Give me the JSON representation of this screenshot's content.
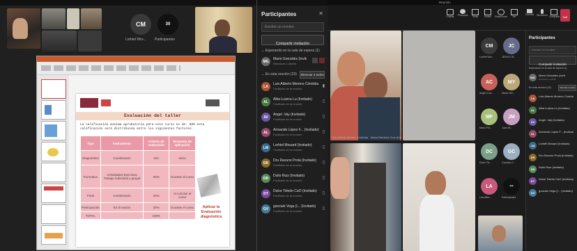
{
  "left_meeting": {
    "tiles": [
      {
        "label": "",
        "avatar": ""
      },
      {
        "label": "Lorhiel Wro...",
        "avatar": "CM"
      },
      {
        "label": "Participantes",
        "avatar": ""
      }
    ],
    "panel": {
      "title": "Participantes",
      "search_placeholder": "Escribir un nombre",
      "share_button": "Compartir invitación",
      "section_lobby": "Esperando en la sala de espera (1)",
      "lobby_person": {
        "name": "Mario González (Invitado)",
        "sub": "Rechazar o admitir"
      },
      "section_meeting": "En esta reunión (23)",
      "mute_all": "Silenciar a todos",
      "people": [
        {
          "initials": "LA",
          "name": "Luis Alberto Moreno Córdoba",
          "sub": "Facilitado de la reunión",
          "color": "#b0553a"
        },
        {
          "initials": "AL",
          "name": "Alba Luarca Lu (Invitado)",
          "sub": "Facilitado de la reunión",
          "color": "#4a7a44"
        },
        {
          "initials": "AV",
          "name": "Angel .Vay (Invitado)",
          "sub": "Facilitado de la reunión",
          "color": "#6b5aa0"
        },
        {
          "initials": "AL",
          "name": "Armando López F... (Invitado)",
          "sub": "Facilitado de la reunión",
          "color": "#9a4a6a"
        },
        {
          "initials": "LM",
          "name": "Lorhiel Mouard (Invitado)",
          "sub": "Facilitado de la reunión",
          "color": "#3a6a8a"
        },
        {
          "initials": "DR",
          "name": "Dru Ravuno Prola (Invitado)",
          "sub": "Facilitado de la reunión",
          "color": "#8a6a2a"
        },
        {
          "initials": "DR",
          "name": "Dulio Ruiz (Invitado)",
          "sub": "Facilitado de la reunión",
          "color": "#5a8a5a"
        },
        {
          "initials": "DT",
          "name": "Dulce Toledo CaO (Invitado)",
          "sub": "Facilitado de la reunión",
          "color": "#7a4a9a"
        },
        {
          "initials": "GV",
          "name": "gonzalo Vega (I... (Invitado)",
          "sub": "Facilitado de la reunión",
          "color": "#4a7a9a"
        }
      ]
    },
    "slide": {
      "title": "Evaluación del taller",
      "intro": "La calificación mínima aprobatoria para este curso es de: 80% esta calificación será distribuida entre los siguientes factores:",
      "headers": [
        "Tipo",
        "Instrumento",
        "Criterio de evaluación",
        "Momento de aplicación"
      ],
      "rows": [
        [
          "Diagnóstica",
          "Cuestionario",
          "N/A",
          "Inicio"
        ],
        [
          "Formativa",
          "Actividades Ejercicios Trabajo individual y grupal",
          "60%",
          "Durante el curso"
        ],
        [
          "Final",
          "Cuestionario",
          "20%",
          "Al concluir el curso"
        ],
        [
          "Participación",
          "En la sesión",
          "20%",
          "Durante el curso"
        ],
        [
          "TOTAL",
          "",
          "100%",
          ""
        ]
      ],
      "note": "Aplicar la Evaluación diagnóstica"
    }
  },
  "right_meeting": {
    "window_title": "Reunión",
    "toolbar": [
      "Charlar",
      "Personas",
      "Vista",
      "Notas",
      "Reaccionar",
      "Ver",
      "Cámara",
      "Micrófono",
      "Compartir",
      "Salir"
    ],
    "avatars": [
      {
        "initials": "CM",
        "label": "Lorhiel Wro...",
        "color": "#3a3a3a"
      },
      {
        "initials": "JC",
        "label": "JESUS CR...",
        "color": "#6a6a8a"
      },
      {
        "initials": "AC",
        "label": "Angel Cruz...",
        "color": "#c7625a"
      },
      {
        "initials": "MY",
        "label": "Maria Yañ...",
        "color": "#b8a87a"
      },
      {
        "initials": "MF",
        "label": "Mario Fer...",
        "color": "#a9c07a"
      },
      {
        "initials": "JM",
        "label": "Juan Mi...",
        "color": "#c7a0c0"
      },
      {
        "initials": "DC",
        "label": "Dulce Tol...",
        "color": "#7aa08a"
      },
      {
        "initials": "GC",
        "label": "Gonzalo C...",
        "color": "#9ab0c0"
      },
      {
        "initials": "LA",
        "label": "Luis Albe...",
        "color": "#c75a7a"
      },
      {
        "initials": "",
        "label": "Participantes",
        "color": "#111111"
      }
    ],
    "video_labels": [
      "Luis Alberto Moreno Córdoba",
      "Mario Ramírez Cruz (Invitado)"
    ],
    "panel": {
      "title": "Participantes",
      "search_placeholder": "Escribir un nombre",
      "share_button": "Compartir invitación",
      "section_lobby": "Esperando en la sala de espera (1)",
      "lobby_person": {
        "name": "Mario González (Invitado)",
        "sub": "Rechazar o admitir"
      },
      "section_meeting": "En esta reunión (23)",
      "mute_all": "Silenciar a todos",
      "people": [
        {
          "initials": "LA",
          "name": "Luis Alberto Moreno Córdoba",
          "color": "#b0553a"
        },
        {
          "initials": "AL",
          "name": "Alba Luarca Lu (Invitado)",
          "color": "#4a7a44"
        },
        {
          "initials": "AV",
          "name": "Angel .Vay (Invitado)",
          "color": "#6b5aa0"
        },
        {
          "initials": "AL",
          "name": "Armando López F... (Invitado)",
          "color": "#9a4a6a"
        },
        {
          "initials": "LM",
          "name": "Lorhiel Mouard (Invitado)",
          "color": "#3a6a8a"
        },
        {
          "initials": "DR",
          "name": "Dru Ravuno Prola (Invitado)",
          "color": "#8a6a2a"
        },
        {
          "initials": "DR",
          "name": "Dulio Ruiz (Invitado)",
          "color": "#5a8a5a"
        },
        {
          "initials": "DT",
          "name": "Dulce Toledo CaO (Invitado)",
          "color": "#7a4a9a"
        },
        {
          "initials": "GV",
          "name": "gonzalo Vega (I... (Invitado)",
          "color": "#4a7a9a"
        }
      ]
    }
  }
}
